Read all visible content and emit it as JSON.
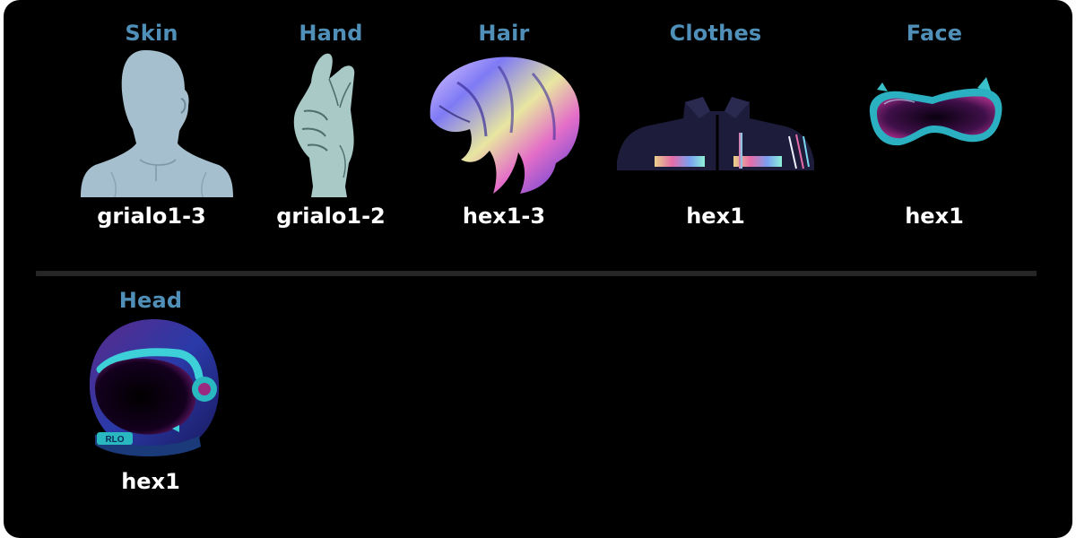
{
  "colors": {
    "background": "#000000",
    "category_label": "#4f8fb8",
    "value_label": "#ffffff",
    "divider": "#262626"
  },
  "traits": [
    {
      "category": "Skin",
      "value": "grialo1-3",
      "icon": "bust-silhouette-icon"
    },
    {
      "category": "Hand",
      "value": "grialo1-2",
      "icon": "pinch-hand-icon"
    },
    {
      "category": "Hair",
      "value": "hex1-3",
      "icon": "holographic-hair-icon"
    },
    {
      "category": "Clothes",
      "value": "hex1",
      "icon": "jacket-icon"
    },
    {
      "category": "Face",
      "value": "hex1",
      "icon": "cat-ear-goggles-icon"
    },
    {
      "category": "Head",
      "value": "hex1",
      "icon": "space-helmet-icon"
    }
  ]
}
